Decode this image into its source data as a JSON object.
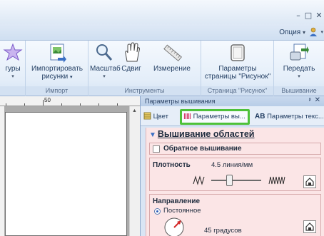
{
  "window": {
    "minimize_glyph": "–",
    "maximize_glyph": "□",
    "close_glyph": "✕"
  },
  "tabrow": {
    "option_label": "Опция",
    "option_caret": "▾",
    "user_caret": "▾"
  },
  "ribbon": {
    "groups": [
      {
        "label": "",
        "buttons": [
          {
            "label": "гуры",
            "icon": "star-shapes-icon",
            "caret": "▾"
          }
        ]
      },
      {
        "label": "Импорт",
        "buttons": [
          {
            "label": "Импортировать рисунки",
            "label_line1": "Импортировать",
            "label_line2": "рисунки",
            "icon": "import-image-icon",
            "caret": "▾"
          }
        ]
      },
      {
        "label": "Инструменты",
        "buttons": [
          {
            "label": "Масштаб",
            "icon": "magnifier-icon",
            "caret": "▾"
          },
          {
            "label": "Сдвиг",
            "icon": "hand-icon"
          },
          {
            "label": "Измерение",
            "icon": "ruler-icon"
          }
        ]
      },
      {
        "label": "Страница \"Рисунок\"",
        "buttons": [
          {
            "label_line1": "Параметры",
            "label_line2": "страницы \"Рисунок\"",
            "icon": "page-settings-icon"
          }
        ]
      },
      {
        "label": "Вышивание",
        "buttons": [
          {
            "label": "Передать",
            "icon": "transfer-icon",
            "caret": "▾"
          }
        ]
      }
    ]
  },
  "ruler": {
    "mark_label": "50"
  },
  "panel": {
    "title": "Параметры вышивания",
    "pin_glyph": "ꟷ",
    "close_glyph": "✕",
    "tabs": [
      {
        "label": "Цвет",
        "icon": "color-palette-icon"
      },
      {
        "label": "Параметры вы...",
        "icon": "embroidery-params-icon",
        "selected": true
      },
      {
        "label": "Параметры текс...",
        "icon": "text-params-icon"
      }
    ],
    "section_title": "Вышивание областей",
    "reverse_stitch_label": "Обратное вышивание",
    "density": {
      "label": "Плотность",
      "value": "4.5 линия/мм",
      "level": 0.36
    },
    "direction": {
      "label": "Направление",
      "mode_label": "Постоянное",
      "angle": "45 градусов"
    }
  },
  "colors": {
    "accent_highlight": "#4ec13a",
    "ribbon_bg": "#e4eef9",
    "panel_content_bg": "#fbe5e6",
    "dial_arrow": "#d42a2a"
  }
}
